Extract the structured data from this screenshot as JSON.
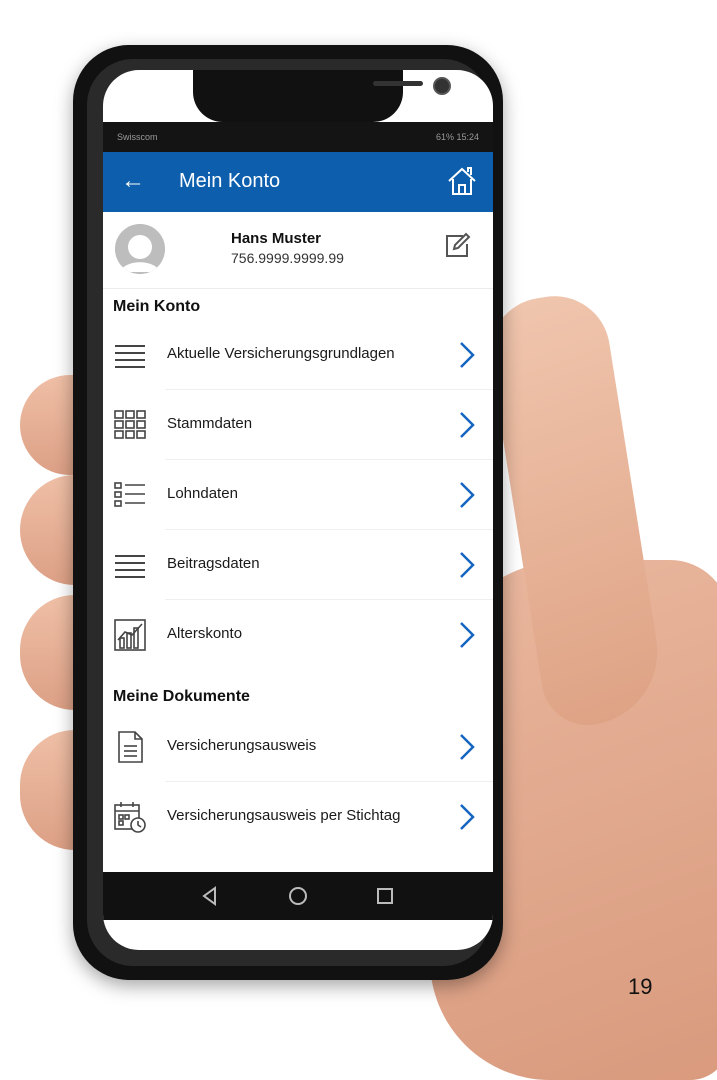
{
  "status_bar": {
    "carrier": "Swisscom",
    "right": "61% 15:24"
  },
  "app_bar": {
    "title": "Mein Konto"
  },
  "profile": {
    "name": "Hans Muster",
    "id": "756.9999.9999.99"
  },
  "sections": [
    {
      "title": "Mein Konto",
      "items": [
        {
          "label": "Aktuelle Versicherungsgrundlagen",
          "icon": "list-lines-icon"
        },
        {
          "label": "Stammdaten",
          "icon": "grid-icon"
        },
        {
          "label": "Lohndaten",
          "icon": "bullet-list-icon"
        },
        {
          "label": "Beitragsdaten",
          "icon": "list-lines-icon"
        },
        {
          "label": "Alterskonto",
          "icon": "chart-icon"
        }
      ]
    },
    {
      "title": "Meine Dokumente",
      "items": [
        {
          "label": "Versicherungsausweis",
          "icon": "document-icon"
        },
        {
          "label": "Versicherungsausweis per Stichtag",
          "icon": "calendar-clock-icon"
        }
      ]
    }
  ],
  "page_number": "19",
  "colors": {
    "accent": "#0d5fad",
    "chevron": "#1565c0"
  }
}
